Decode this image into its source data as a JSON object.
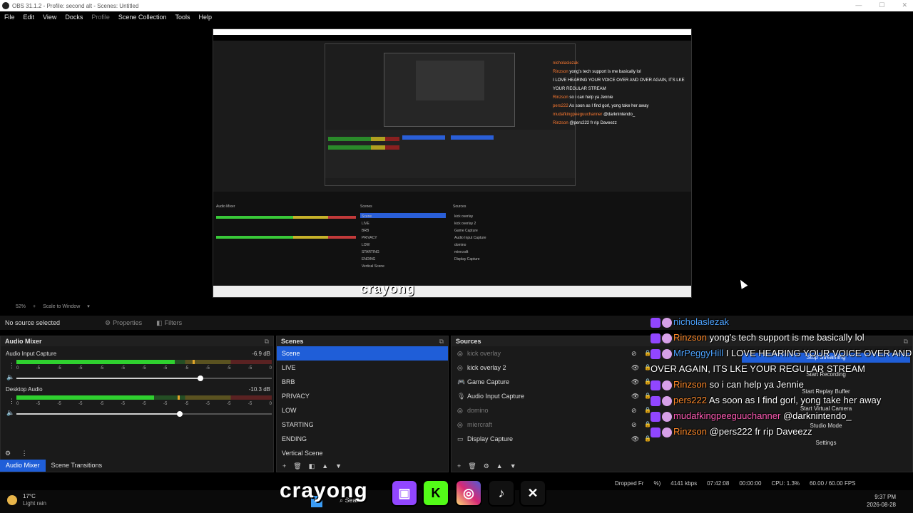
{
  "window": {
    "title": "OBS 31.1.2 - Profile: second alt - Scenes: Untitled"
  },
  "menu": [
    "File",
    "Edit",
    "View",
    "Docks",
    "Profile",
    "Scene Collection",
    "Tools",
    "Help"
  ],
  "menu_disabled_index": 4,
  "zoom": {
    "percent": "52%",
    "scale_label": "Scale to Window"
  },
  "props": {
    "no_source": "No source selected",
    "properties": "Properties",
    "filters": "Filters"
  },
  "mixer": {
    "title": "Audio Mixer",
    "tracks": [
      {
        "name": "Audio Input Capture",
        "db": "-6.9 dB",
        "level": 0.62,
        "peak": 0.69,
        "volume": 0.72
      },
      {
        "name": "Desktop Audio",
        "db": "-10.3 dB",
        "level": 0.54,
        "peak": 0.63,
        "volume": 0.64
      }
    ],
    "scale": [
      "0",
      "-5",
      "-5",
      "-5",
      "-5",
      "-5",
      "-5",
      "-5",
      "-5",
      "-5",
      "-5",
      "-5",
      "0"
    ]
  },
  "scenes": {
    "title": "Scenes",
    "items": [
      "Scene",
      "LIVE",
      "BRB",
      "PRIVACY",
      "LOW",
      "STARTING",
      "ENDING",
      "Vertical Scene"
    ],
    "selected": 0
  },
  "sources": {
    "title": "Sources",
    "items": [
      {
        "name": "kick overlay",
        "hidden": true
      },
      {
        "name": "kick overlay 2",
        "hidden": false
      },
      {
        "name": "Game Capture",
        "hidden": false
      },
      {
        "name": "Audio Input Capture",
        "hidden": false
      },
      {
        "name": "domino",
        "hidden": true
      },
      {
        "name": "miercraft",
        "hidden": true
      },
      {
        "name": "Display Capture",
        "hidden": false
      }
    ]
  },
  "tabs": {
    "audio_mixer": "Audio Mixer",
    "scene_transitions": "Scene Transitions"
  },
  "controls": {
    "stop_streaming": "Stop Streaming",
    "start_recording": "Start Recording",
    "start_replay": "Start Replay Buffer",
    "start_virtual_camera": "Start Virtual Camera",
    "studio_mode": "Studio Mode",
    "settings": "Settings"
  },
  "chat": [
    {
      "user": "nicholaslezak",
      "text": "",
      "user_color": "blue"
    },
    {
      "user": "Rinzson",
      "text": "yong's tech support is me basically lol",
      "user_color": "orange"
    },
    {
      "user": "MrPeggyHill",
      "text": "I LOVE HEARING YOUR VOICE OVER AND OVER AGAIN, ITS LKE YOUR REGULAR STREAM",
      "user_color": "blue"
    },
    {
      "user": "Rinzson",
      "text": "so i can help ya Jennie",
      "user_color": "orange"
    },
    {
      "user": "pers222",
      "text": "As soon as I find gorl, yong take her away",
      "user_color": "orange"
    },
    {
      "user": "mudafkingpeeguuchanner",
      "text": "@darknintendo_",
      "user_color": "pink"
    },
    {
      "user": "Rinzson",
      "text": "@pers222 fr rip Daveezz",
      "user_color": "orange"
    }
  ],
  "status": {
    "dropped": "Dropped Fr",
    "pct": "%)",
    "kbps": "4141 kbps",
    "stream_time": "07:42:08",
    "rec_time": "00:00:00",
    "cpu": "CPU: 1.3%",
    "fps": "60.00 / 60.00 FPS"
  },
  "overlay": {
    "brand": "crayong"
  },
  "nested_chat": [
    {
      "user": "nicholaslezak",
      "text": ""
    },
    {
      "user": "Rinzson",
      "text": "yong's tech support is me basically lol"
    },
    {
      "user": "",
      "text": "I LOVE HEARING YOUR VOICE OVER AND OVER AGAIN, ITS LKE YOUR REGULAR STREAM"
    },
    {
      "user": "Rinzson",
      "text": "so i can help ya Jennie"
    },
    {
      "user": "pers222",
      "text": "As soon as I find gorl, yong take her away"
    },
    {
      "user": "mudafkingpeeguuchanner",
      "text": "@darknintendo_"
    },
    {
      "user": "Rinzson",
      "text": "@pers222 fr rip Daveezz"
    }
  ],
  "taskbar": {
    "temp": "17°C",
    "condition": "Light rain",
    "search": "Search",
    "time": "9:37 PM",
    "date": "2026-08-28"
  }
}
